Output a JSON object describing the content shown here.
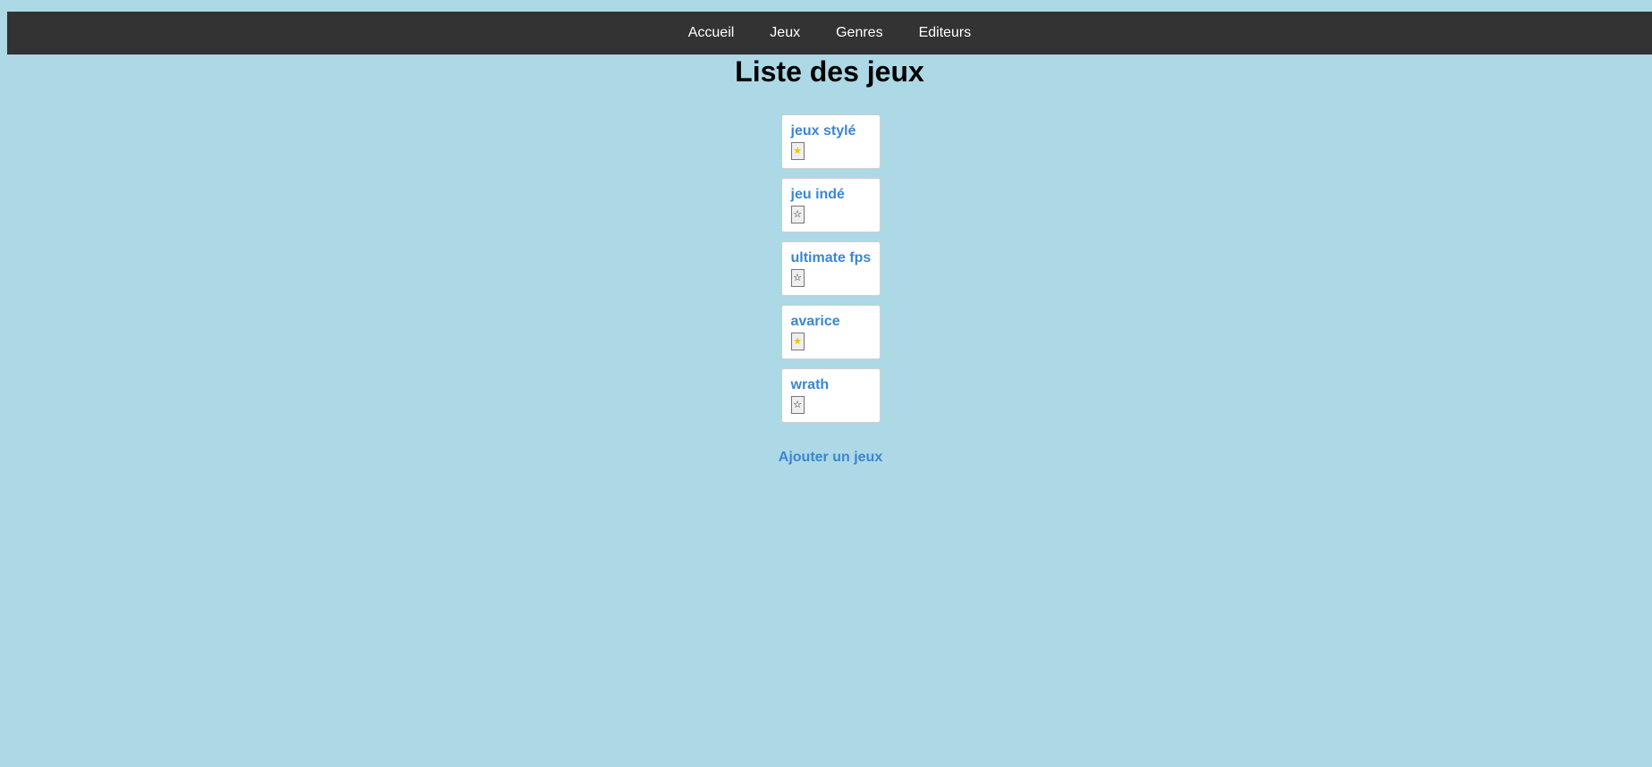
{
  "nav": {
    "items": [
      "Accueil",
      "Jeux",
      "Genres",
      "Editeurs"
    ]
  },
  "page": {
    "title": "Liste des jeux"
  },
  "games": [
    {
      "title": "jeux stylé",
      "favorite": true,
      "star": "★"
    },
    {
      "title": "jeu indé",
      "favorite": false,
      "star": "☆"
    },
    {
      "title": "ultimate fps",
      "favorite": false,
      "star": "☆"
    },
    {
      "title": "avarice",
      "favorite": true,
      "star": "★"
    },
    {
      "title": "wrath",
      "favorite": false,
      "star": "☆"
    }
  ],
  "actions": {
    "add_game_label": "Ajouter un jeux"
  },
  "colors": {
    "background": "#add8e6",
    "navbar": "#333333",
    "link": "#3a86d4",
    "favorite_star": "#f2c200"
  },
  "icons": {
    "favorite_on": "star-filled-icon",
    "favorite_off": "star-outline-icon"
  }
}
